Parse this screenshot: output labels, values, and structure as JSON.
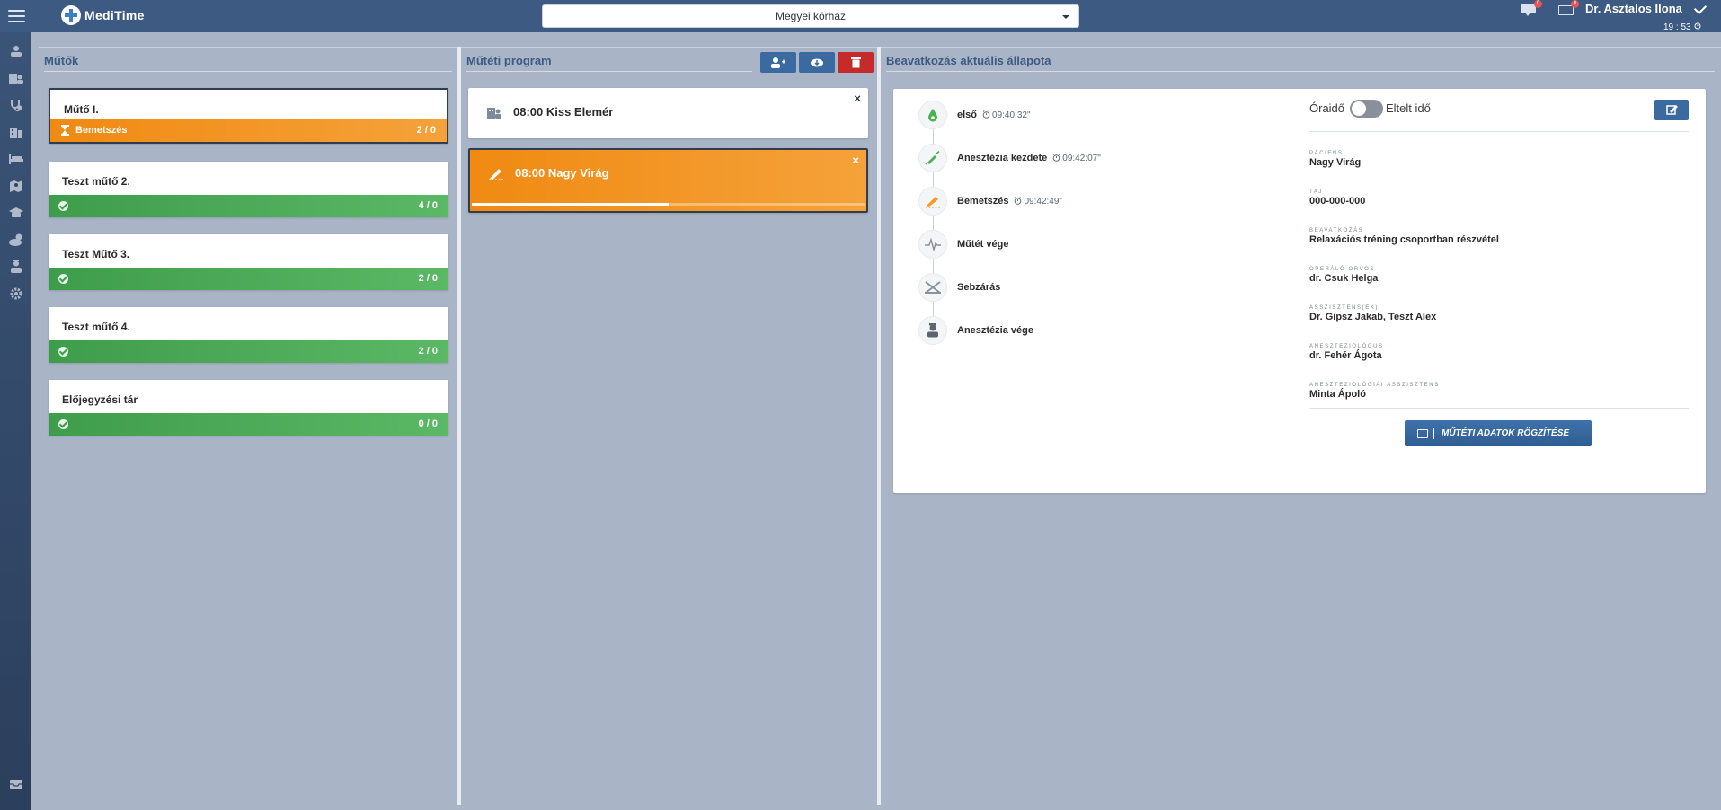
{
  "app": {
    "name": "MediTime",
    "hospital_select": "Megyei kórház",
    "user": "Dr. Asztalos Ilona",
    "clock": "19 : 53",
    "chat_badge": "0",
    "mail_badge": "0"
  },
  "sidebar": {
    "items": [
      "patients-icon",
      "reception-icon",
      "stethoscope-icon",
      "building-icon",
      "bed-icon",
      "map-icon",
      "graduation-icon",
      "weather-icon",
      "staff-icon",
      "settings-icon"
    ],
    "bottom": "inbox-icon"
  },
  "rooms_panel": {
    "title": "Műtők",
    "rooms": [
      {
        "name": "Műtő I.",
        "status": "Bemetszés",
        "count": "2 / 0",
        "active": true
      },
      {
        "name": "Teszt műtő 2.",
        "status": "",
        "count": "4 / 0",
        "active": false
      },
      {
        "name": "Teszt Műtő 3.",
        "status": "",
        "count": "2 / 0",
        "active": false
      },
      {
        "name": "Teszt műtő 4.",
        "status": "",
        "count": "2 / 0",
        "active": false
      },
      {
        "name": "Előjegyzési tár",
        "status": "",
        "count": "0 / 0",
        "active": false
      }
    ]
  },
  "program_panel": {
    "title": "Műtéti program",
    "items": [
      {
        "text": "08:00 Kiss Elemér",
        "close": "×",
        "active": false
      },
      {
        "text": "08:00 Nagy Virág",
        "close": "×",
        "active": true,
        "progress": 0.5
      }
    ]
  },
  "status_panel": {
    "title": "Beavatkozás aktuális állapota",
    "toggle_left": "Óraidő",
    "toggle_right": "Eltelt idő",
    "steps": [
      {
        "label": "első",
        "time": "09:40:32\"",
        "icon": "drop-icon",
        "color": "#4caf50"
      },
      {
        "label": "Anesztézia kezdete",
        "time": "09:42:07\"",
        "icon": "syringe-icon",
        "color": "#4caf50"
      },
      {
        "label": "Bemetszés",
        "time": "09:42:49\"",
        "icon": "scalpel-icon",
        "color": "#f59a23"
      },
      {
        "label": "Műtét vége",
        "time": "",
        "icon": "pulse-icon",
        "color": "#8a94a0"
      },
      {
        "label": "Sebzárás",
        "time": "",
        "icon": "scissors-icon",
        "color": "#8a94a0"
      },
      {
        "label": "Anesztézia vége",
        "time": "",
        "icon": "doctor-icon",
        "color": "#5a6472"
      }
    ],
    "info": [
      {
        "label": "Páciens",
        "value": "Nagy Virág"
      },
      {
        "label": "TAJ",
        "value": "000-000-000"
      },
      {
        "label": "Beavatkozás",
        "value": "Relaxációs tréning csoportban részvétel"
      },
      {
        "label": "Operáló orvos",
        "value": "dr. Csuk Helga"
      },
      {
        "label": "Asszisztens(ek)",
        "value": "Dr. Gipsz Jakab, Teszt Alex"
      },
      {
        "label": "Aneszteziológus",
        "value": "dr. Fehér Ágota"
      },
      {
        "label": "Aneszteziológiai asszisztens",
        "value": "Minta Ápoló"
      }
    ],
    "record_button": "MŰTÉTI ADATOK RÖGZÍTÉSE"
  }
}
